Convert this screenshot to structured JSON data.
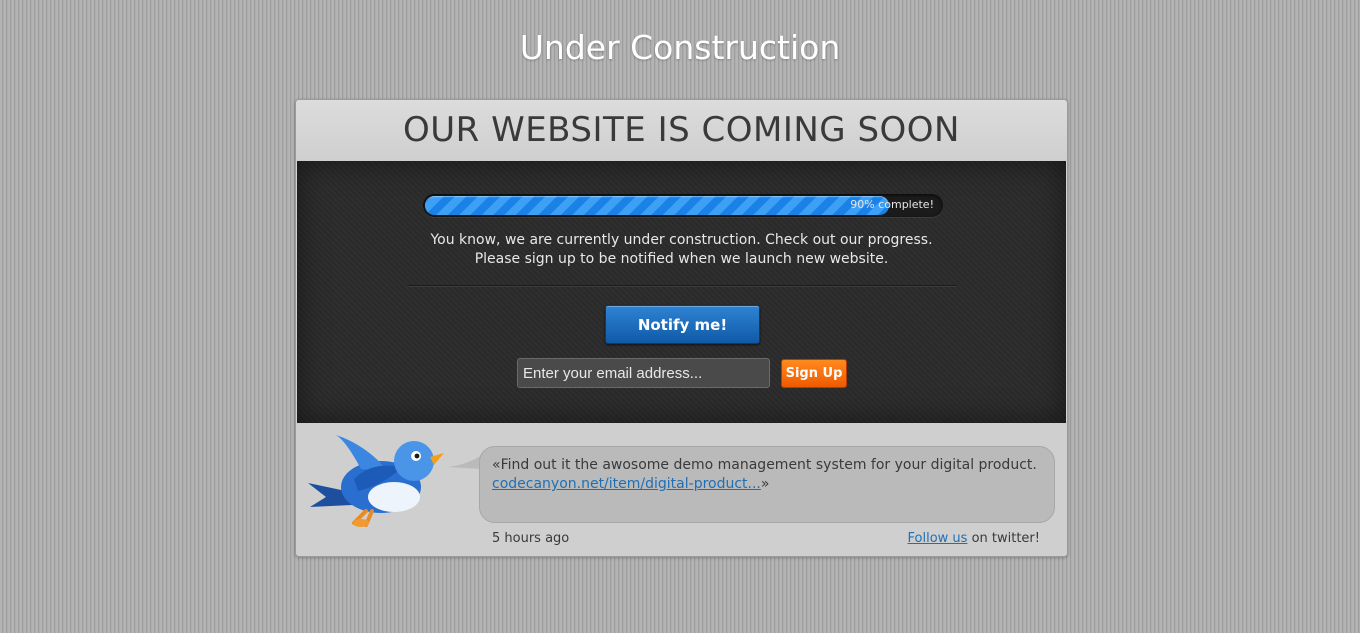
{
  "page": {
    "title": "Under Construction"
  },
  "card": {
    "heading": "OUR WEBSITE IS COMING SOON"
  },
  "progress": {
    "percent": 90,
    "label": "90% complete!",
    "accent_color": "#1a82e6"
  },
  "message": {
    "line1": "You know, we are currently under construction. Check out our progress.",
    "line2": "Please sign up to be notified when we launch new website."
  },
  "notify_button": {
    "label": "Notify me!"
  },
  "signup": {
    "email_placeholder": "Enter your email address...",
    "button_label": "Sign Up",
    "button_color": "#f05a00"
  },
  "twitter": {
    "icon": "twitter-bird-icon",
    "tweet_prefix": "«Find out it the awosome demo management system for your digital product.",
    "tweet_link": "codecanyon.net/item/digital-product...",
    "tweet_suffix": "»",
    "time_ago": "5 hours ago",
    "follow_link": "Follow us",
    "follow_suffix": " on twitter!"
  }
}
